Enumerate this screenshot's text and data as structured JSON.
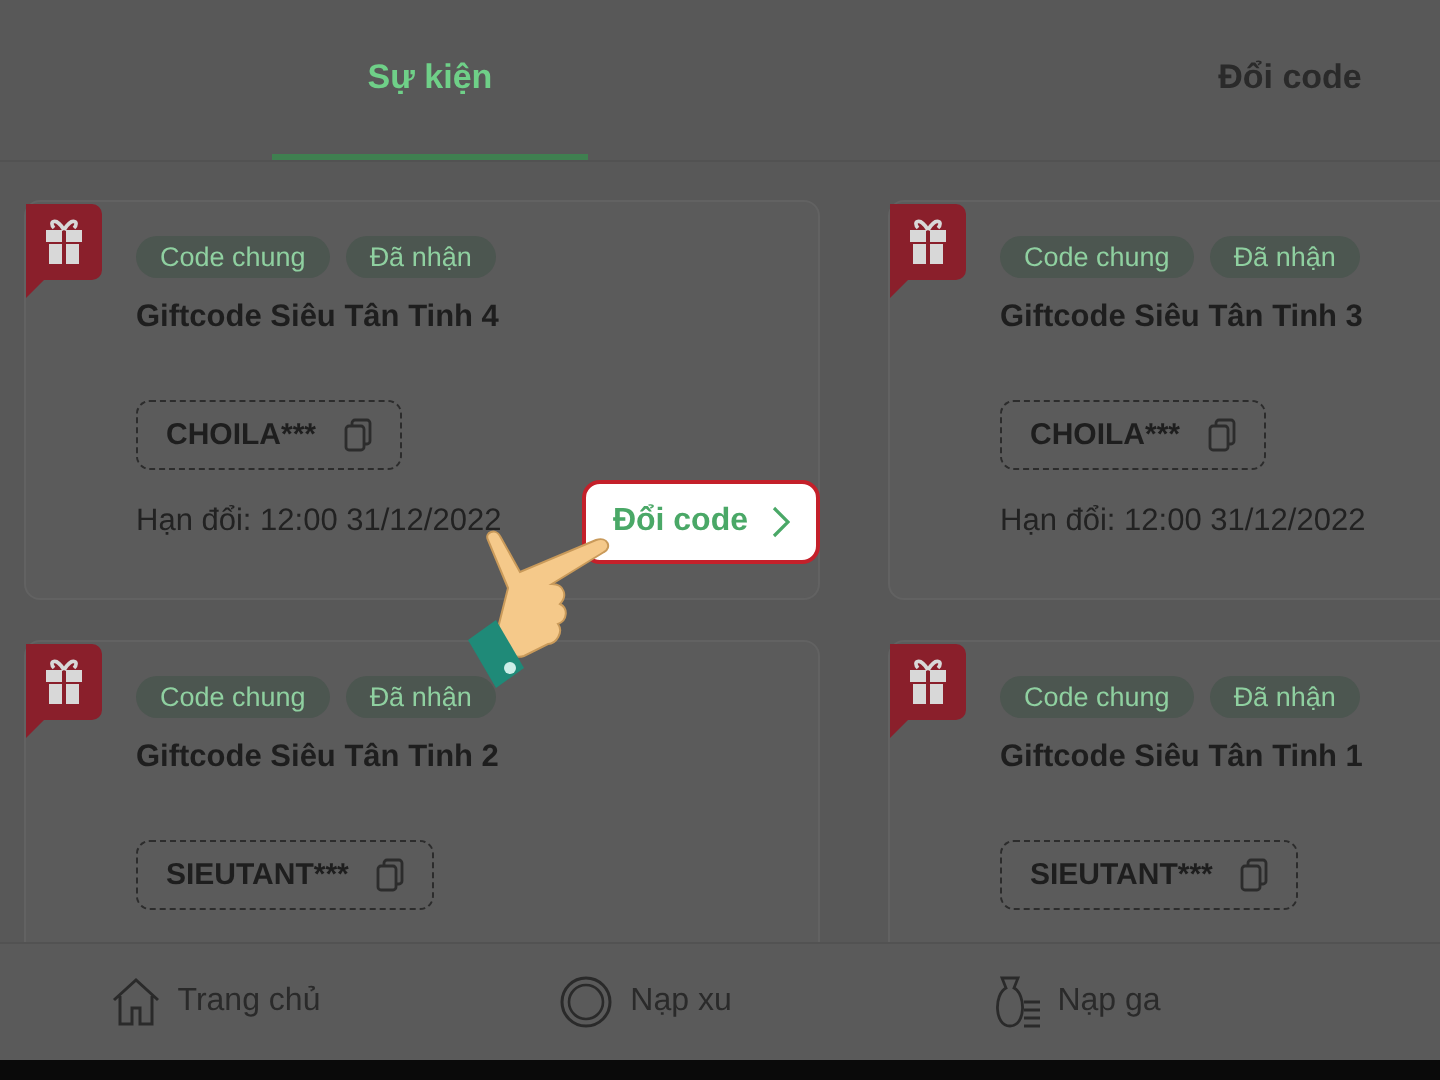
{
  "tabs": [
    {
      "label": "Sự kiện",
      "selected": true
    },
    {
      "label": "Đổi code",
      "selected": false
    }
  ],
  "cards": [
    {
      "tags": [
        "Code chung",
        "Đã nhận"
      ],
      "title": "Giftcode Siêu Tân Tinh 4",
      "code": "CHOILA***",
      "expiry": "Hạn đổi: 12:00 31/12/2022",
      "redeem_button": "Đổi code"
    },
    {
      "tags": [
        "Code chung",
        "Đã nhận"
      ],
      "title": "Giftcode Siêu Tân Tinh 3",
      "code": "CHOILA***",
      "expiry": "Hạn đổi: 12:00 31/12/2022"
    },
    {
      "tags": [
        "Code chung",
        "Đã nhận"
      ],
      "title": "Giftcode Siêu Tân Tinh 2",
      "code": "SIEUTANT***"
    },
    {
      "tags": [
        "Code chung",
        "Đã nhận"
      ],
      "title": "Giftcode Siêu Tân Tinh 1",
      "code": "SIEUTANT***"
    }
  ],
  "bottom_nav": [
    "Trang chủ",
    "Nạp xu",
    "Nạp ga"
  ]
}
